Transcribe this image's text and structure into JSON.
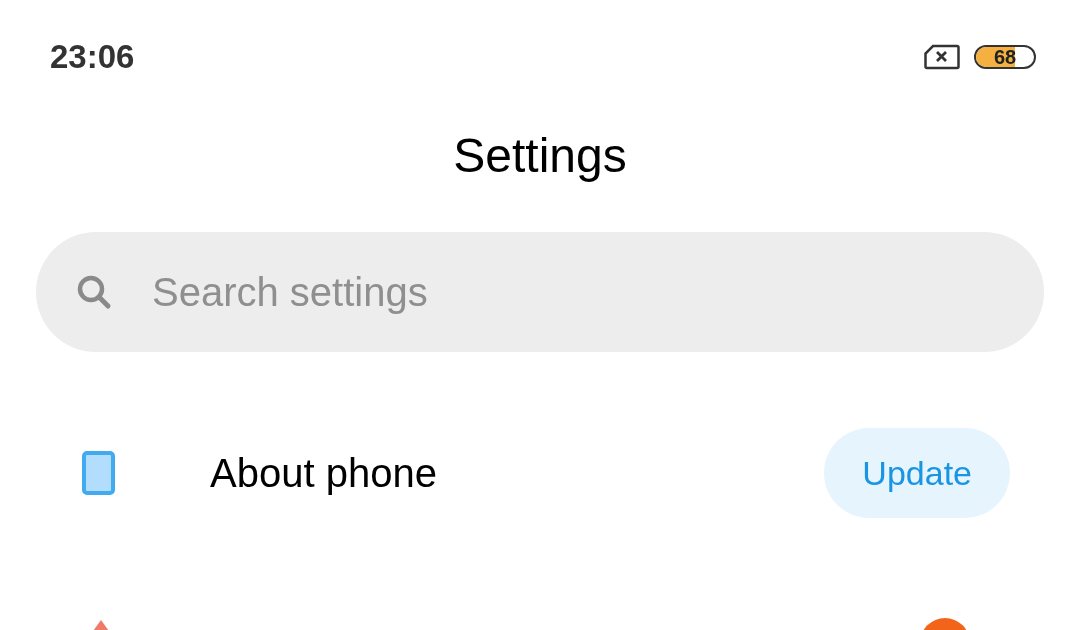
{
  "status_bar": {
    "time": "23:06",
    "battery": {
      "level": 0.68,
      "reading": "68"
    }
  },
  "title": "Settings",
  "search": {
    "placeholder": "Search settings"
  },
  "items": [
    {
      "label": "About phone",
      "badge": "Update"
    }
  ]
}
